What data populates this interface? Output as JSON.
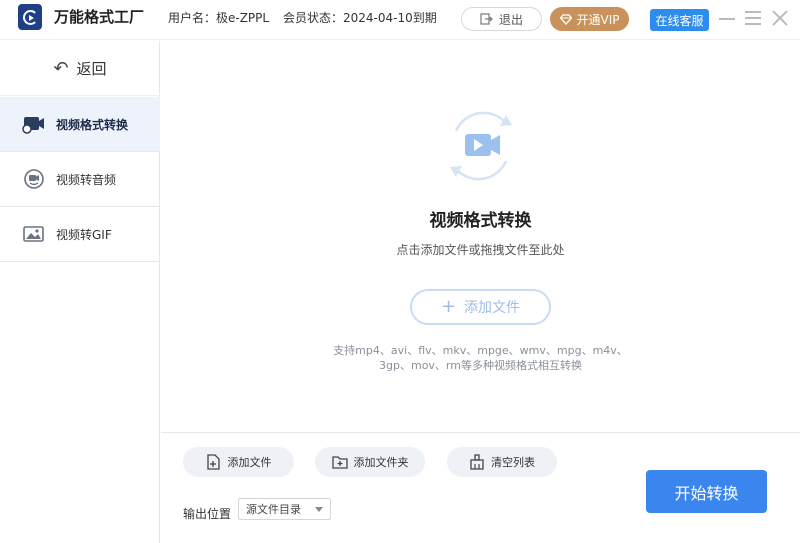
{
  "app": {
    "title": "万能格式工厂",
    "user_label": "用户名：极e-ZPPL",
    "member_status": "会员状态：2024-04-10到期",
    "logout_label": "退出",
    "vip_label": "开通VIP",
    "service_label": "在线客服"
  },
  "sidebar": {
    "back_label": "返回",
    "items": [
      {
        "label": "视频格式转换",
        "icon": "video-convert-icon",
        "active": true
      },
      {
        "label": "视频转音频",
        "icon": "video-audio-icon",
        "active": false
      },
      {
        "label": "视频转GIF",
        "icon": "gif-image-icon",
        "active": false
      }
    ]
  },
  "main": {
    "title": "视频格式转换",
    "subtitle": "点击添加文件或拖拽文件至此处",
    "add_file_label": "添加文件",
    "formats_line1": "支持mp4、avi、flv、mkv、mpge、wmv、mpg、m4v、",
    "formats_line2": "3gp、mov、rm等多种视频格式相互转换"
  },
  "toolbar": {
    "add_file": "添加文件",
    "add_folder": "添加文件夹",
    "clear_list": "清空列表",
    "output_label": "输出位置",
    "output_value": "源文件目录",
    "start_label": "开始转换"
  },
  "colors": {
    "accent": "#3a86ee",
    "vip": "#c9925a",
    "service": "#2d8cf0",
    "active_bg": "#eef3fb"
  }
}
